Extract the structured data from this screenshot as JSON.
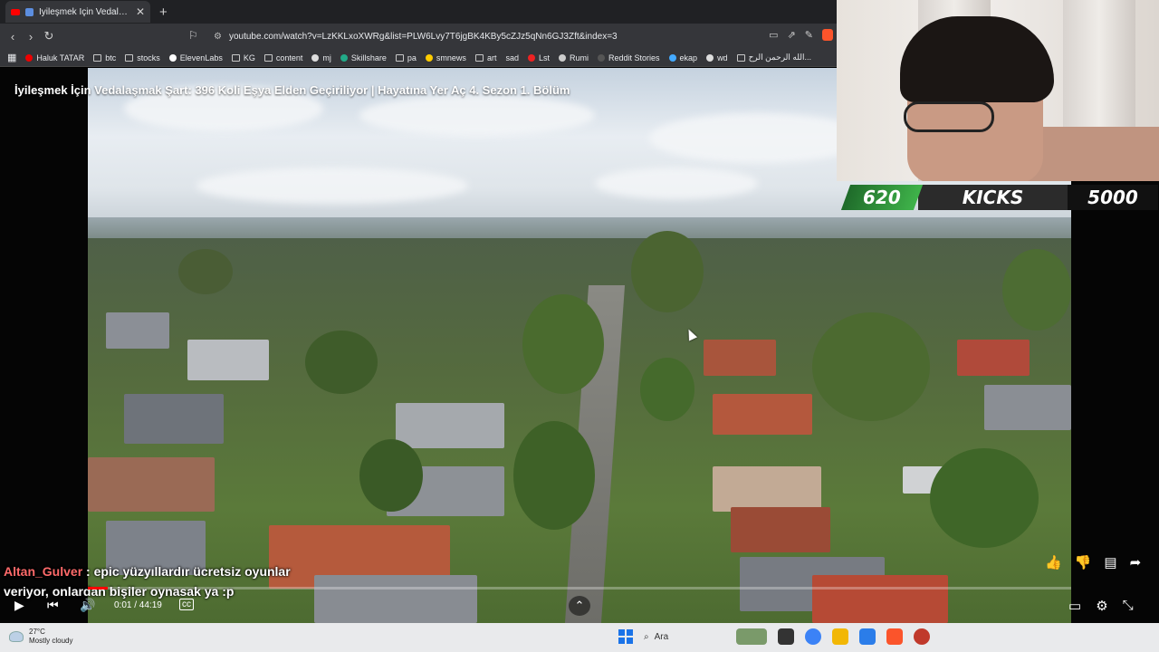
{
  "browser": {
    "tab_title": "İyileşmek İçin Vedalaşmak Şart",
    "url": "youtube.com/watch?v=LzKKLxoXWRg&list=PLW6Lvy7T6jgBK4KBy5cZJz5qNn6GJ3Zft&index=3",
    "bookmarks": [
      "Haluk TATAR",
      "btc",
      "stocks",
      "ElevenLabs",
      "KG",
      "content",
      "mj",
      "Skillshare",
      "pa",
      "smnews",
      "art",
      "sad",
      "Lst",
      "Rumi",
      "Reddit Stories",
      "ekap",
      "wd",
      "الله الرحمن الرح..."
    ]
  },
  "video": {
    "title": "İyileşmek İçin Vedalaşmak Şart: 396 Koli Eşya Elden Geçiriliyor | Hayatına Yer Aç 4. Sezon 1. Bölüm",
    "time": "0:01 / 44:19",
    "progress_fraction": 0.0004
  },
  "stats": {
    "left": "620",
    "middle": "KICKS",
    "right": "5000"
  },
  "chat": {
    "user": "Altan_Gulver",
    "message": "epic yüzyıllardır ücretsiz oyunlar veriyor, onlardan bişiler oynasak ya :p"
  },
  "taskbar": {
    "temperature": "27°C",
    "weather": "Mostly cloudy",
    "search_label": "Ara"
  },
  "colors": {
    "accent_red": "#ff0000",
    "stats_green": "#3fb34a",
    "chat_user": "#ff6a6a"
  }
}
